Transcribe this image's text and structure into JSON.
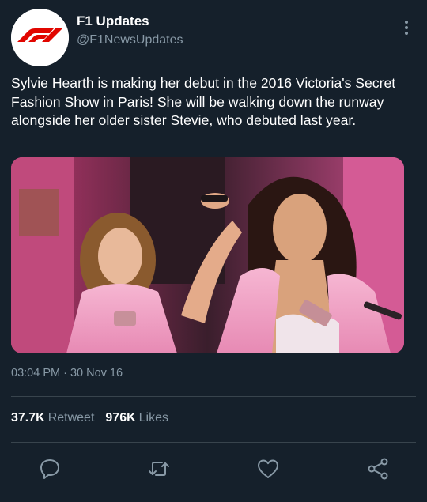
{
  "account": {
    "display_name": "F1 Updates",
    "handle": "@F1NewsUpdates"
  },
  "tweet": {
    "text": "Sylvie Hearth is making her debut in the 2016 Victoria's Secret Fashion Show in Paris! She will be walking down the runway alongside her older sister Stevie, who debuted last year.",
    "timestamp": "03:04 PM · 30 Nov 16"
  },
  "stats": {
    "retweets_count": "37.7K",
    "retweets_label": "Retweet",
    "likes_count": "976K",
    "likes_label": "Likes"
  },
  "colors": {
    "background": "#15202b",
    "secondary_text": "#8899a6",
    "divider": "#38444d",
    "f1_red": "#e10600"
  },
  "icons": {
    "reply": "reply-icon",
    "retweet": "retweet-icon",
    "like": "heart-icon",
    "share": "share-icon",
    "more": "more-vertical-icon"
  }
}
